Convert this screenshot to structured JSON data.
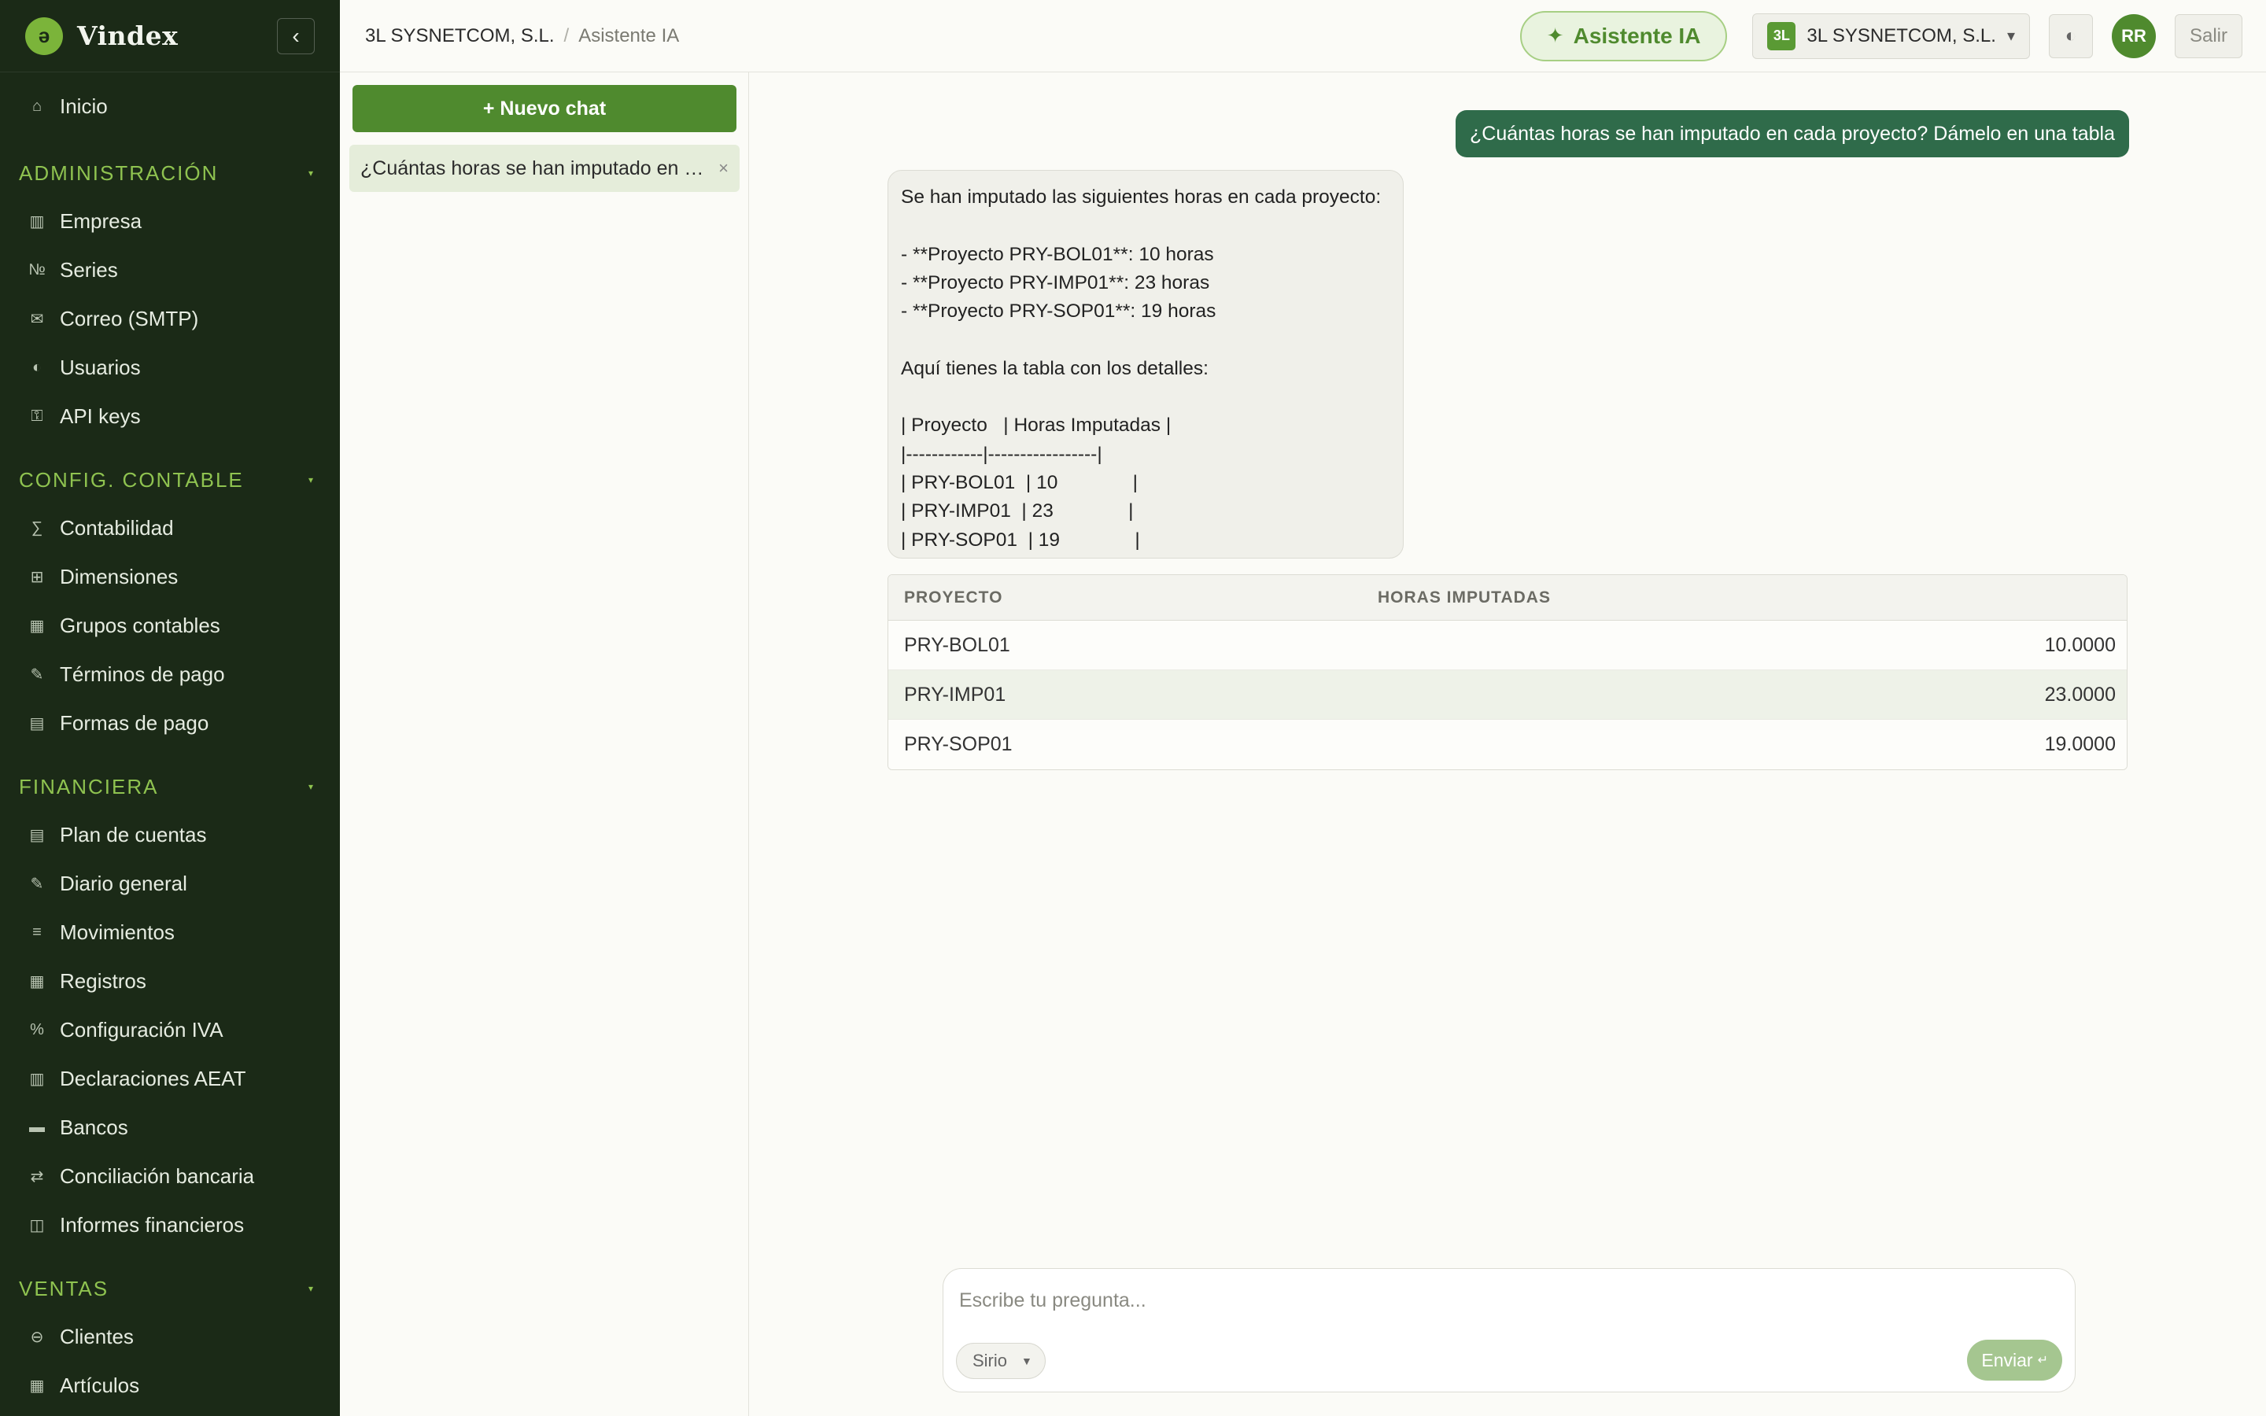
{
  "app": {
    "name": "Vindex"
  },
  "sidebar": {
    "home": {
      "label": "Inicio",
      "icon": "home-icon"
    },
    "sections": [
      {
        "title": "ADMINISTRACIÓN",
        "items": [
          {
            "label": "Empresa",
            "icon": "building-icon",
            "glyph": "▥"
          },
          {
            "label": "Series",
            "icon": "numero-icon",
            "glyph": "№"
          },
          {
            "label": "Correo (SMTP)",
            "icon": "mail-icon",
            "glyph": "✉"
          },
          {
            "label": "Usuarios",
            "icon": "users-icon",
            "glyph": "◐"
          },
          {
            "label": "API keys",
            "icon": "key-icon",
            "glyph": "⚿"
          }
        ]
      },
      {
        "title": "CONFIG. CONTABLE",
        "items": [
          {
            "label": "Contabilidad",
            "icon": "sigma-icon",
            "glyph": "∑"
          },
          {
            "label": "Dimensiones",
            "icon": "grid-icon",
            "glyph": "⊞"
          },
          {
            "label": "Grupos contables",
            "icon": "table-icon",
            "glyph": "▦"
          },
          {
            "label": "Términos de pago",
            "icon": "pen-icon",
            "glyph": "✎"
          },
          {
            "label": "Formas de pago",
            "icon": "list-icon",
            "glyph": "▤"
          }
        ]
      },
      {
        "title": "FINANCIERA",
        "items": [
          {
            "label": "Plan de cuentas",
            "icon": "ledger-icon",
            "glyph": "▤"
          },
          {
            "label": "Diario general",
            "icon": "pen-icon",
            "glyph": "✎"
          },
          {
            "label": "Movimientos",
            "icon": "lines-icon",
            "glyph": "≡"
          },
          {
            "label": "Registros",
            "icon": "table-icon",
            "glyph": "▦"
          },
          {
            "label": "Configuración IVA",
            "icon": "percent-icon",
            "glyph": "%"
          },
          {
            "label": "Declaraciones AEAT",
            "icon": "document-icon",
            "glyph": "▥"
          },
          {
            "label": "Bancos",
            "icon": "bank-icon",
            "glyph": "▬"
          },
          {
            "label": "Conciliación bancaria",
            "icon": "swap-icon",
            "glyph": "⇄"
          },
          {
            "label": "Informes financieros",
            "icon": "book-icon",
            "glyph": "◫"
          }
        ]
      },
      {
        "title": "VENTAS",
        "items": [
          {
            "label": "Clientes",
            "icon": "customer-icon",
            "glyph": "⊖"
          },
          {
            "label": "Artículos",
            "icon": "box-icon",
            "glyph": "▦"
          }
        ]
      }
    ]
  },
  "topbar": {
    "breadcrumb": {
      "company": "3L SYSNETCOM, S.L.",
      "separator": "/",
      "current": "Asistente IA"
    },
    "ai_button": "Asistente IA",
    "company_badge": "3L",
    "company_name": "3L SYSNETCOM, S.L.",
    "avatar_initials": "RR",
    "logout": "Salir"
  },
  "chat_list": {
    "new_chat": "+ Nuevo chat",
    "items": [
      {
        "title": "¿Cuántas horas se han imputado en cada proyecto? Dámelo en una tabla"
      }
    ]
  },
  "conversation": {
    "user_message": "¿Cuántas horas se han imputado en cada proyecto? Dámelo en una tabla",
    "assistant_message": "Se han imputado las siguientes horas en cada proyecto:\n\n- **Proyecto PRY-BOL01**: 10 horas\n- **Proyecto PRY-IMP01**: 23 horas\n- **Proyecto PRY-SOP01**: 19 horas\n\nAquí tienes la tabla con los detalles:\n\n| Proyecto   | Horas Imputadas |\n|------------|-----------------|\n| PRY-BOL01  | 10              |\n| PRY-IMP01  | 23              |\n| PRY-SOP01  | 19              |",
    "table": {
      "headers": [
        "PROYECTO",
        "HORAS IMPUTADAS"
      ],
      "rows": [
        [
          "PRY-BOL01",
          "10.0000"
        ],
        [
          "PRY-IMP01",
          "23.0000"
        ],
        [
          "PRY-SOP01",
          "19.0000"
        ]
      ]
    }
  },
  "composer": {
    "placeholder": "Escribe tu pregunta...",
    "model": "Sirio",
    "send": "Enviar"
  },
  "colors": {
    "sidebar_bg": "#1b2a17",
    "accent": "#4f8a2e",
    "section_title": "#8fc350",
    "user_bubble": "#2f6b4a"
  }
}
